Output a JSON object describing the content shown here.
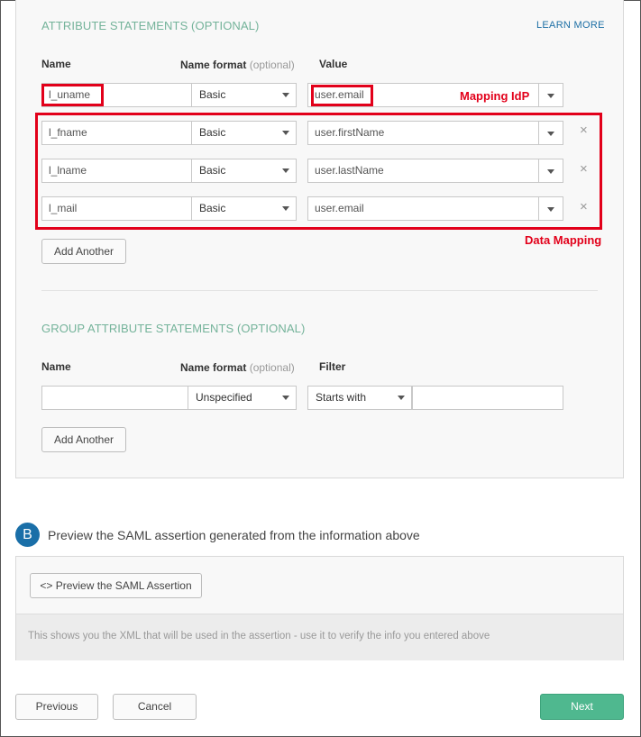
{
  "attribute_section": {
    "title": "ATTRIBUTE STATEMENTS (OPTIONAL)",
    "learn_more": "LEARN MORE",
    "col_name": "Name",
    "col_format": "Name format",
    "col_format_hint": "(optional)",
    "col_value": "Value",
    "rows": [
      {
        "name": "l_uname",
        "format": "Basic",
        "value": "user.email"
      },
      {
        "name": "l_fname",
        "format": "Basic",
        "value": "user.firstName"
      },
      {
        "name": "l_lname",
        "format": "Basic",
        "value": "user.lastName"
      },
      {
        "name": "l_mail",
        "format": "Basic",
        "value": "user.email"
      }
    ],
    "add_another": "Add Another"
  },
  "annotations": {
    "mapping_idp": "Mapping IdP",
    "data_mapping": "Data Mapping"
  },
  "group_section": {
    "title": "GROUP ATTRIBUTE STATEMENTS (OPTIONAL)",
    "col_name": "Name",
    "col_format": "Name format",
    "col_format_hint": "(optional)",
    "col_filter": "Filter",
    "name_value": "",
    "format": "Unspecified",
    "filter_type": "Starts with",
    "filter_value": "",
    "add_another": "Add Another"
  },
  "preview_section": {
    "step": "B",
    "heading": "Preview the SAML assertion generated from the information above",
    "button": "Preview the SAML Assertion",
    "hint": "This shows you the XML that will be used in the assertion - use it to verify the info you entered above"
  },
  "footer": {
    "previous": "Previous",
    "cancel": "Cancel",
    "next": "Next"
  },
  "colors": {
    "accent": "#74b39a",
    "link": "#1d6fa5",
    "annotation": "#e2001a",
    "next_button": "#4fb88f",
    "step_badge": "#1a6fa8"
  }
}
